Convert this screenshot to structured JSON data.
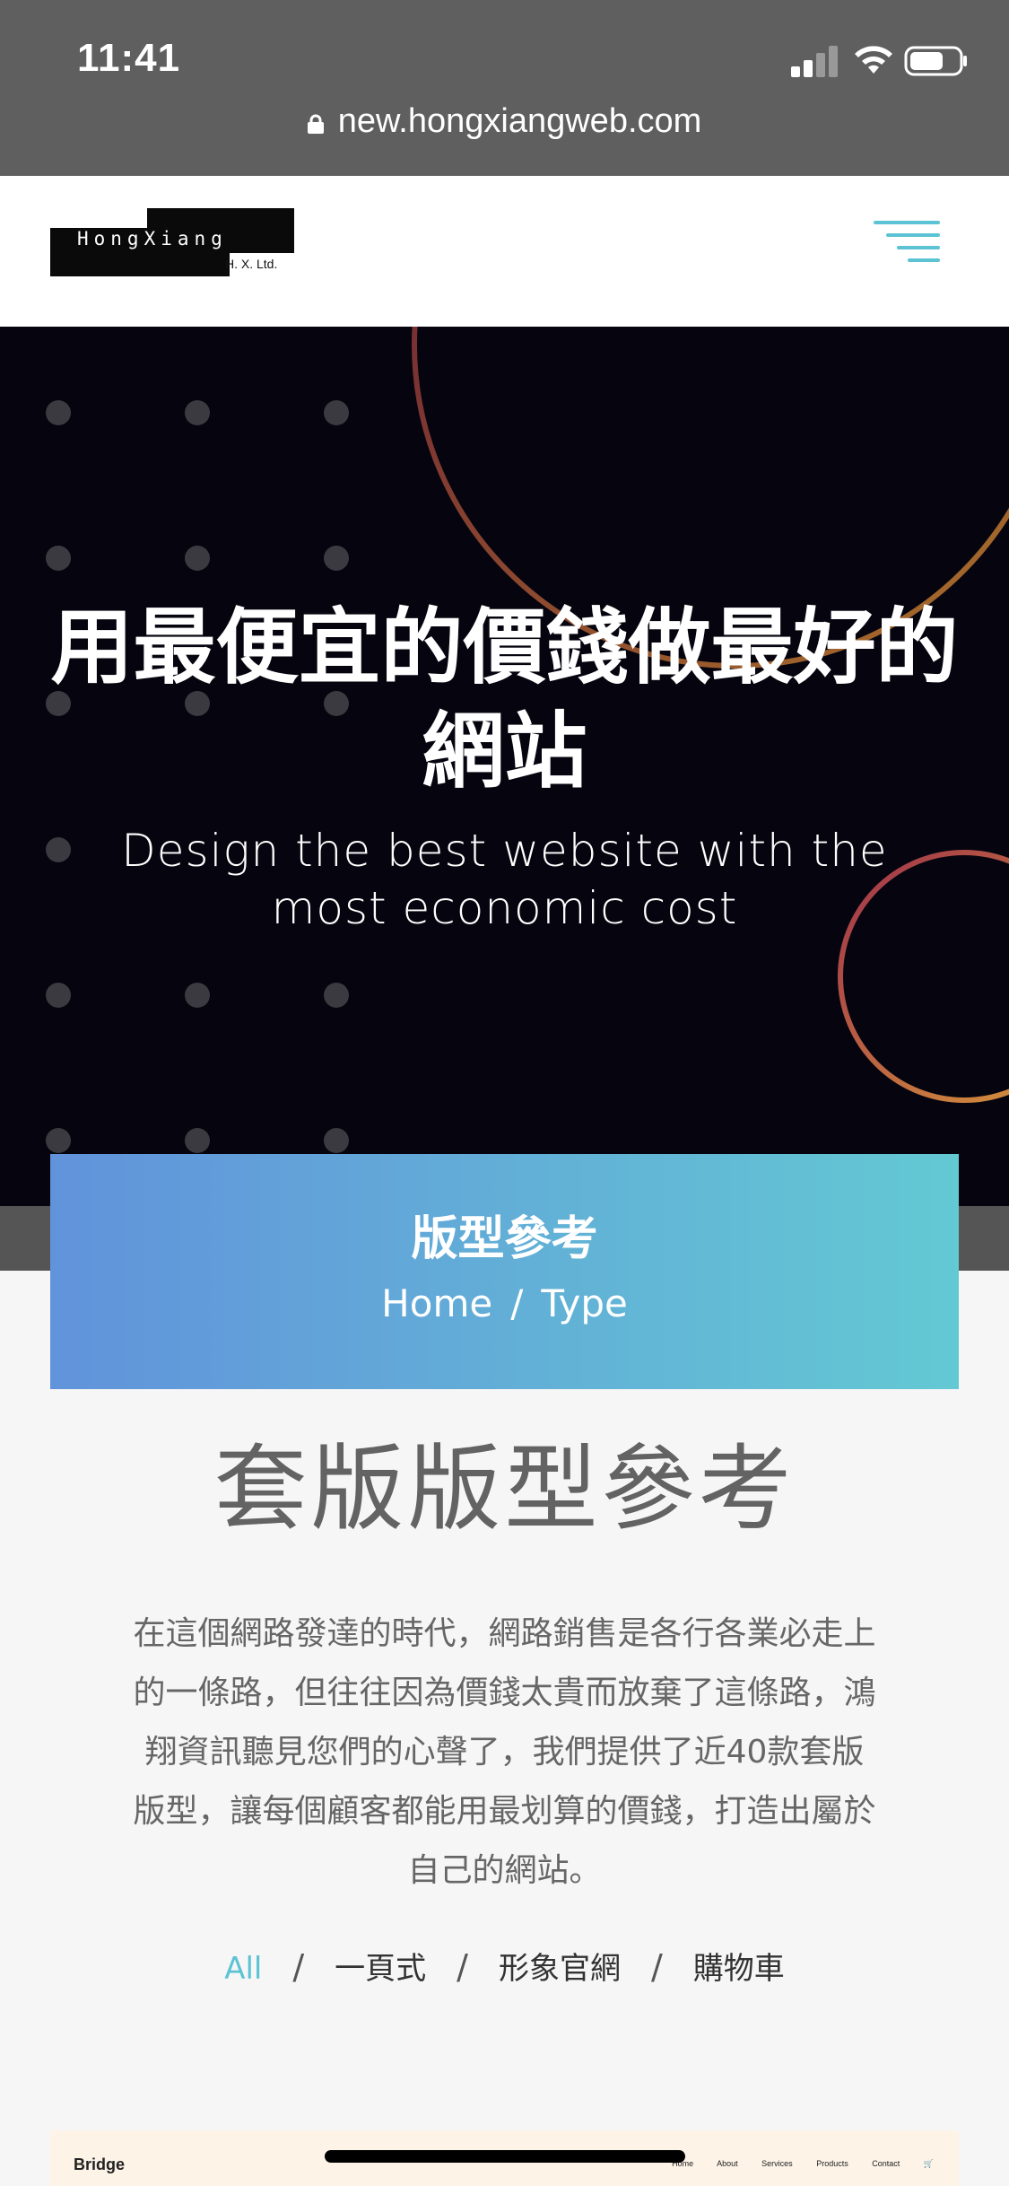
{
  "status_bar": {
    "time": "11:41"
  },
  "browser": {
    "url": "new.hongxiangweb.com"
  },
  "header": {
    "logo_text": "HongXiang",
    "logo_subtext": "H. X. Ltd."
  },
  "hero": {
    "title": "用最便宜的價錢做最好的網站",
    "subtitle": "Design the best website with the most economic cost"
  },
  "banner": {
    "title": "版型參考",
    "breadcrumb": {
      "home": "Home",
      "separator": "/",
      "current": "Type"
    }
  },
  "section": {
    "title": "套版版型參考",
    "description": "在這個網路發達的時代，網路銷售是各行各業必走上的一條路，但往往因為價錢太貴而放棄了這條路，鴻翔資訊聽見您們的心聲了，我們提供了近40款套版版型，讓每個顧客都能用最划算的價錢，打造出屬於自己的網站。"
  },
  "filters": {
    "separator": "/",
    "items": [
      {
        "label": "All",
        "active": true
      },
      {
        "label": "一頁式",
        "active": false
      },
      {
        "label": "形象官網",
        "active": false
      },
      {
        "label": "購物車",
        "active": false
      }
    ]
  },
  "preview": {
    "brand": "Bridge",
    "nav": [
      "Home",
      "About",
      "Services",
      "Products",
      "Contact",
      "🛒"
    ]
  },
  "colors": {
    "accent": "#5bc3d3",
    "banner_start": "#6193db",
    "banner_end": "#63c9d3",
    "hero_bg": "#06050f"
  }
}
